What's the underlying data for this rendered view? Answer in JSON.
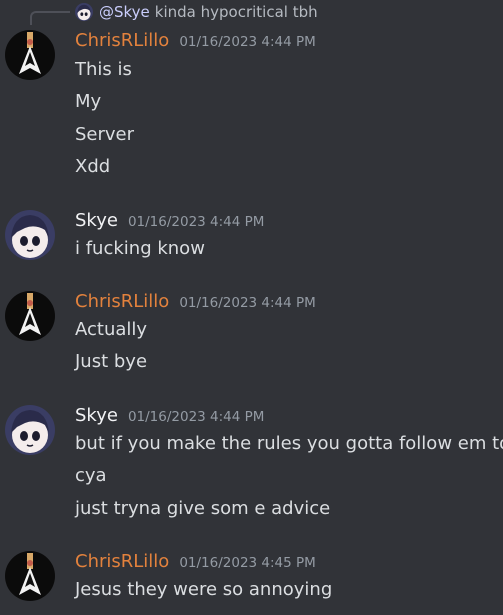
{
  "colors": {
    "background": "#313338",
    "username_chris": "#e3823d",
    "username_skye": "#f2f3f5",
    "message_text": "#dbdee1",
    "timestamp": "#949ba4",
    "mention": "#c9cdfb"
  },
  "reply": {
    "mention": "@Skye",
    "text": "kinda hypocritical tbh"
  },
  "messages": [
    {
      "username": "ChrisRLillo",
      "timestamp": "01/16/2023 4:44 PM",
      "lines": [
        "This is",
        "My",
        "Server",
        "Xdd"
      ]
    },
    {
      "username": "Skye",
      "timestamp": "01/16/2023 4:44 PM",
      "lines": [
        "i fucking know"
      ]
    },
    {
      "username": "ChrisRLillo",
      "timestamp": "01/16/2023 4:44 PM",
      "lines": [
        "Actually",
        "Just bye"
      ]
    },
    {
      "username": "Skye",
      "timestamp": "01/16/2023 4:44 PM",
      "lines": [
        "but if you make the rules you gotta follow em too",
        "cya",
        "just tryna give som e advice"
      ]
    },
    {
      "username": "ChrisRLillo",
      "timestamp": "01/16/2023 4:45 PM",
      "lines": [
        "Jesus they were so annoying"
      ]
    }
  ]
}
